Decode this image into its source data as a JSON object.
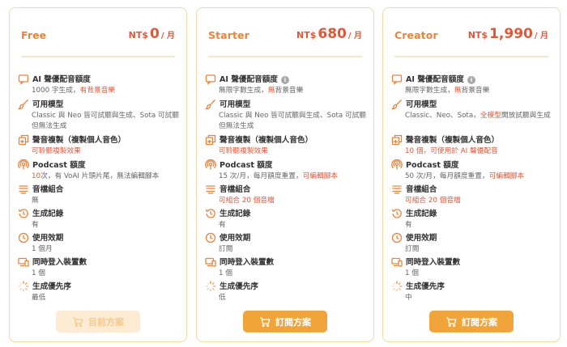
{
  "colors": {
    "accent": "#f0a43a",
    "price": "#e0573a",
    "title": "#e8843d",
    "border": "#f3d9a8"
  },
  "plans": [
    {
      "name": "Free",
      "currency": "NT$",
      "amount": "0",
      "per": "/ 月",
      "features": [
        {
          "icon": "chat-icon",
          "title": "AI 聲優配音額度",
          "info": false,
          "lines": [
            [
              "1000 字生成，",
              "n"
            ],
            [
              "有背景音樂",
              "h"
            ]
          ]
        },
        {
          "icon": "brush-icon",
          "title": "可用模型",
          "info": false,
          "lines": [
            [
              "Classic 與 Neo 皆可試聽與生成、Sota 可試聽但無法生成",
              "n"
            ]
          ]
        },
        {
          "icon": "voice-copy-icon",
          "title": "聲音複製（複製個人音色）",
          "info": false,
          "lines": [
            [
              "可聆聽複製效果",
              "h"
            ]
          ]
        },
        {
          "icon": "podcast-icon",
          "title": "Podcast 額度",
          "info": false,
          "lines": [
            [
              "10",
              "h"
            ],
            [
              "次，有 VoAI 片頭片尾，無法編輯腳本",
              "n"
            ]
          ]
        },
        {
          "icon": "audio-mix-icon",
          "title": "音檔組合",
          "info": false,
          "lines": [
            [
              "無",
              "n"
            ]
          ]
        },
        {
          "icon": "history-icon",
          "title": "生成記錄",
          "info": false,
          "lines": [
            [
              "有",
              "n"
            ]
          ]
        },
        {
          "icon": "clock-icon",
          "title": "使用效期",
          "info": false,
          "lines": [
            [
              "1 個月",
              "n"
            ]
          ]
        },
        {
          "icon": "devices-icon",
          "title": "同時登入裝置數",
          "info": false,
          "lines": [
            [
              "1 個",
              "n"
            ]
          ]
        },
        {
          "icon": "loading-icon",
          "title": "生成優先序",
          "info": false,
          "lines": [
            [
              "最低",
              "n"
            ]
          ]
        }
      ],
      "button": "目前方案",
      "button_disabled": true
    },
    {
      "name": "Starter",
      "currency": "NT$",
      "amount": "680",
      "per": "/ 月",
      "features": [
        {
          "icon": "chat-icon",
          "title": "AI 聲優配音額度",
          "info": true,
          "lines": [
            [
              "無限字數生成，",
              "n"
            ],
            [
              "無",
              "h"
            ],
            [
              "背景音樂",
              "n"
            ]
          ]
        },
        {
          "icon": "brush-icon",
          "title": "可用模型",
          "info": false,
          "lines": [
            [
              "Classic 與 Neo 皆可試聽與生成、Sota 可試聽但無法生成",
              "n"
            ]
          ]
        },
        {
          "icon": "voice-copy-icon",
          "title": "聲音複製（複製個人音色）",
          "info": false,
          "lines": [
            [
              "可聆聽複製效果",
              "h"
            ]
          ]
        },
        {
          "icon": "podcast-icon",
          "title": "Podcast 額度",
          "info": false,
          "lines": [
            [
              "15 次/月，每月額度重置，",
              "n"
            ],
            [
              "可編輯腳本",
              "h"
            ]
          ]
        },
        {
          "icon": "audio-mix-icon",
          "title": "音檔組合",
          "info": false,
          "lines": [
            [
              "可組合 20 個音檔",
              "h"
            ]
          ]
        },
        {
          "icon": "history-icon",
          "title": "生成記錄",
          "info": false,
          "lines": [
            [
              "有",
              "n"
            ]
          ]
        },
        {
          "icon": "clock-icon",
          "title": "使用效期",
          "info": false,
          "lines": [
            [
              "訂閱",
              "n"
            ]
          ]
        },
        {
          "icon": "devices-icon",
          "title": "同時登入裝置數",
          "info": false,
          "lines": [
            [
              "1 個",
              "n"
            ]
          ]
        },
        {
          "icon": "loading-icon",
          "title": "生成優先序",
          "info": false,
          "lines": [
            [
              "低",
              "n"
            ]
          ]
        }
      ],
      "button": "訂閱方案",
      "button_disabled": false
    },
    {
      "name": "Creator",
      "currency": "NT$",
      "amount": "1,990",
      "per": "/ 月",
      "features": [
        {
          "icon": "chat-icon",
          "title": "AI 聲優配音額度",
          "info": true,
          "lines": [
            [
              "無限字數生成，",
              "n"
            ],
            [
              "無",
              "h"
            ],
            [
              "背景音樂",
              "n"
            ]
          ]
        },
        {
          "icon": "brush-icon",
          "title": "可用模型",
          "info": false,
          "lines": [
            [
              "Classic、Neo、Sota，",
              "n"
            ],
            [
              "全模型",
              "h"
            ],
            [
              "開放試聽與生成",
              "n"
            ]
          ]
        },
        {
          "icon": "voice-copy-icon",
          "title": "聲音複製（複製個人音色）",
          "info": false,
          "lines": [
            [
              "10 個，可使用於 AI 聲優配音",
              "h"
            ]
          ]
        },
        {
          "icon": "podcast-icon",
          "title": "Podcast 額度",
          "info": false,
          "lines": [
            [
              "50 次/月，每月額度重置，",
              "n"
            ],
            [
              "可編輯腳本",
              "h"
            ]
          ]
        },
        {
          "icon": "audio-mix-icon",
          "title": "音檔組合",
          "info": false,
          "lines": [
            [
              "可組合 20 個音檔",
              "h"
            ]
          ]
        },
        {
          "icon": "history-icon",
          "title": "生成記錄",
          "info": false,
          "lines": [
            [
              "有",
              "n"
            ]
          ]
        },
        {
          "icon": "clock-icon",
          "title": "使用效期",
          "info": false,
          "lines": [
            [
              "訂閱",
              "n"
            ]
          ]
        },
        {
          "icon": "devices-icon",
          "title": "同時登入裝置數",
          "info": false,
          "lines": [
            [
              "1 個",
              "n"
            ]
          ]
        },
        {
          "icon": "loading-icon",
          "title": "生成優先序",
          "info": false,
          "lines": [
            [
              "中",
              "n"
            ]
          ]
        }
      ],
      "button": "訂閱方案",
      "button_disabled": false
    }
  ]
}
